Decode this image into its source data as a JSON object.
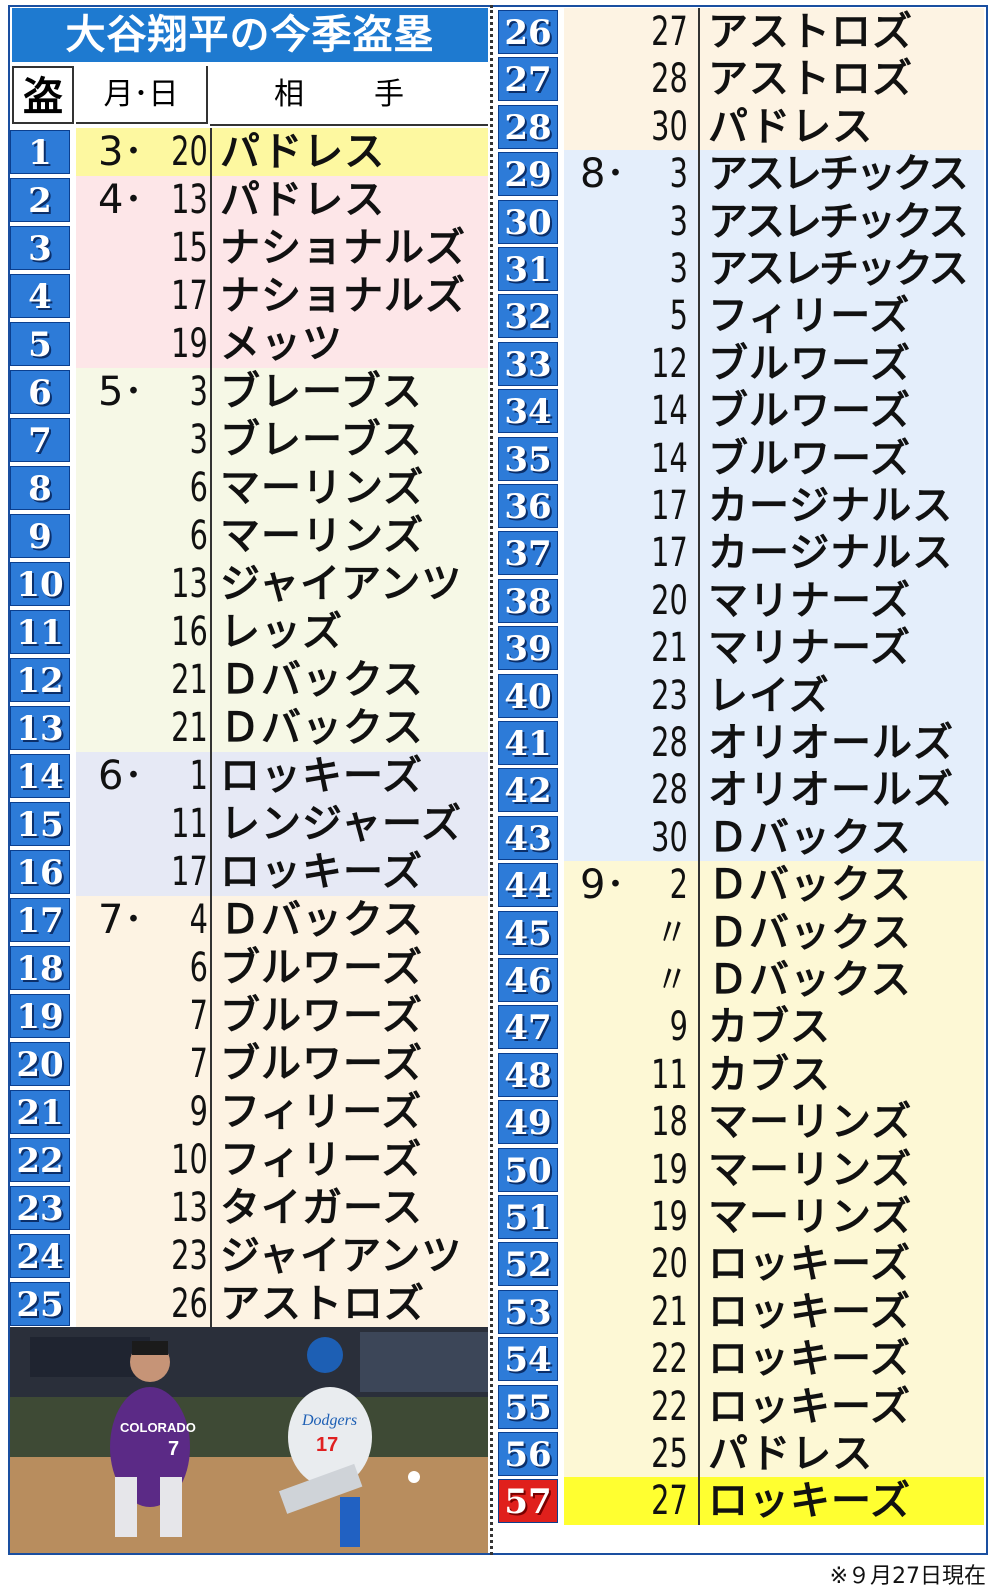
{
  "title": "大谷翔平の今季盗塁",
  "header": {
    "steal": "盗",
    "date": "月･日",
    "opponent": "相　手"
  },
  "colors": {
    "num_bg": "#2d7bd8",
    "num_highlight": "#e0201c",
    "march": "#fdf8a0",
    "april": "#fde6e8",
    "may": "#f6f8e6",
    "june": "#e6e9f5",
    "july": "#fdf3e3",
    "august": "#e4eefb",
    "september": "#fdf8d5",
    "last": "#ffff30"
  },
  "left_rows": [
    {
      "n": "1",
      "mon": "3･",
      "day": "20",
      "opp": "パドレス",
      "band": "march"
    },
    {
      "n": "2",
      "mon": "4･",
      "day": "13",
      "opp": "パドレス",
      "band": "april"
    },
    {
      "n": "3",
      "mon": "",
      "day": "15",
      "opp": "ナショナルズ",
      "band": "april"
    },
    {
      "n": "4",
      "mon": "",
      "day": "17",
      "opp": "ナショナルズ",
      "band": "april"
    },
    {
      "n": "5",
      "mon": "",
      "day": "19",
      "opp": "メッツ",
      "band": "april"
    },
    {
      "n": "6",
      "mon": "5･",
      "day": "3",
      "opp": "ブレーブス",
      "band": "may"
    },
    {
      "n": "7",
      "mon": "",
      "day": "3",
      "opp": "ブレーブス",
      "band": "may"
    },
    {
      "n": "8",
      "mon": "",
      "day": "6",
      "opp": "マーリンズ",
      "band": "may"
    },
    {
      "n": "9",
      "mon": "",
      "day": "6",
      "opp": "マーリンズ",
      "band": "may"
    },
    {
      "n": "10",
      "mon": "",
      "day": "13",
      "opp": "ジャイアンツ",
      "band": "may"
    },
    {
      "n": "11",
      "mon": "",
      "day": "16",
      "opp": "レッズ",
      "band": "may"
    },
    {
      "n": "12",
      "mon": "",
      "day": "21",
      "opp": "Ｄバックス",
      "band": "may"
    },
    {
      "n": "13",
      "mon": "",
      "day": "21",
      "opp": "Ｄバックス",
      "band": "may"
    },
    {
      "n": "14",
      "mon": "6･",
      "day": "1",
      "opp": "ロッキーズ",
      "band": "june"
    },
    {
      "n": "15",
      "mon": "",
      "day": "11",
      "opp": "レンジャーズ",
      "band": "june"
    },
    {
      "n": "16",
      "mon": "",
      "day": "17",
      "opp": "ロッキーズ",
      "band": "june"
    },
    {
      "n": "17",
      "mon": "7･",
      "day": "4",
      "opp": "Ｄバックス",
      "band": "july"
    },
    {
      "n": "18",
      "mon": "",
      "day": "6",
      "opp": "ブルワーズ",
      "band": "july"
    },
    {
      "n": "19",
      "mon": "",
      "day": "7",
      "opp": "ブルワーズ",
      "band": "july"
    },
    {
      "n": "20",
      "mon": "",
      "day": "7",
      "opp": "ブルワーズ",
      "band": "july"
    },
    {
      "n": "21",
      "mon": "",
      "day": "9",
      "opp": "フィリーズ",
      "band": "july"
    },
    {
      "n": "22",
      "mon": "",
      "day": "10",
      "opp": "フィリーズ",
      "band": "july"
    },
    {
      "n": "23",
      "mon": "",
      "day": "13",
      "opp": "タイガース",
      "band": "july"
    },
    {
      "n": "24",
      "mon": "",
      "day": "23",
      "opp": "ジャイアンツ",
      "band": "july"
    },
    {
      "n": "25",
      "mon": "",
      "day": "26",
      "opp": "アストロズ",
      "band": "july"
    }
  ],
  "right_rows": [
    {
      "n": "26",
      "mon": "",
      "day": "27",
      "opp": "アストロズ",
      "band": "july"
    },
    {
      "n": "27",
      "mon": "",
      "day": "28",
      "opp": "アストロズ",
      "band": "july"
    },
    {
      "n": "28",
      "mon": "",
      "day": "30",
      "opp": "パドレス",
      "band": "july"
    },
    {
      "n": "29",
      "mon": "8･",
      "day": "3",
      "opp": "アスレチックス",
      "band": "august"
    },
    {
      "n": "30",
      "mon": "",
      "day": "3",
      "opp": "アスレチックス",
      "band": "august"
    },
    {
      "n": "31",
      "mon": "",
      "day": "3",
      "opp": "アスレチックス",
      "band": "august"
    },
    {
      "n": "32",
      "mon": "",
      "day": "5",
      "opp": "フィリーズ",
      "band": "august"
    },
    {
      "n": "33",
      "mon": "",
      "day": "12",
      "opp": "ブルワーズ",
      "band": "august"
    },
    {
      "n": "34",
      "mon": "",
      "day": "14",
      "opp": "ブルワーズ",
      "band": "august"
    },
    {
      "n": "35",
      "mon": "",
      "day": "14",
      "opp": "ブルワーズ",
      "band": "august"
    },
    {
      "n": "36",
      "mon": "",
      "day": "17",
      "opp": "カージナルス",
      "band": "august"
    },
    {
      "n": "37",
      "mon": "",
      "day": "17",
      "opp": "カージナルス",
      "band": "august"
    },
    {
      "n": "38",
      "mon": "",
      "day": "20",
      "opp": "マリナーズ",
      "band": "august"
    },
    {
      "n": "39",
      "mon": "",
      "day": "21",
      "opp": "マリナーズ",
      "band": "august"
    },
    {
      "n": "40",
      "mon": "",
      "day": "23",
      "opp": "レイズ",
      "band": "august"
    },
    {
      "n": "41",
      "mon": "",
      "day": "28",
      "opp": "オリオールズ",
      "band": "august"
    },
    {
      "n": "42",
      "mon": "",
      "day": "28",
      "opp": "オリオールズ",
      "band": "august"
    },
    {
      "n": "43",
      "mon": "",
      "day": "30",
      "opp": "Ｄバックス",
      "band": "august"
    },
    {
      "n": "44",
      "mon": "9･",
      "day": "2",
      "opp": "Ｄバックス",
      "band": "september"
    },
    {
      "n": "45",
      "mon": "",
      "day": "〃",
      "opp": "Ｄバックス",
      "band": "september"
    },
    {
      "n": "46",
      "mon": "",
      "day": "〃",
      "opp": "Ｄバックス",
      "band": "september"
    },
    {
      "n": "47",
      "mon": "",
      "day": "9",
      "opp": "カブス",
      "band": "september"
    },
    {
      "n": "48",
      "mon": "",
      "day": "11",
      "opp": "カブス",
      "band": "september"
    },
    {
      "n": "49",
      "mon": "",
      "day": "18",
      "opp": "マーリンズ",
      "band": "september"
    },
    {
      "n": "50",
      "mon": "",
      "day": "19",
      "opp": "マーリンズ",
      "band": "september"
    },
    {
      "n": "51",
      "mon": "",
      "day": "19",
      "opp": "マーリンズ",
      "band": "september"
    },
    {
      "n": "52",
      "mon": "",
      "day": "20",
      "opp": "ロッキーズ",
      "band": "september"
    },
    {
      "n": "53",
      "mon": "",
      "day": "21",
      "opp": "ロッキーズ",
      "band": "september"
    },
    {
      "n": "54",
      "mon": "",
      "day": "22",
      "opp": "ロッキーズ",
      "band": "september"
    },
    {
      "n": "55",
      "mon": "",
      "day": "22",
      "opp": "ロッキーズ",
      "band": "september"
    },
    {
      "n": "56",
      "mon": "",
      "day": "25",
      "opp": "パドレス",
      "band": "september"
    },
    {
      "n": "57",
      "mon": "",
      "day": "27",
      "opp": "ロッキーズ",
      "band": "last",
      "highlight": true
    }
  ],
  "photo": {
    "text_left": "COLORADO",
    "num_left": "7",
    "text_right": "Dodgers",
    "num_right": "17"
  },
  "note": "※９月27日現在"
}
